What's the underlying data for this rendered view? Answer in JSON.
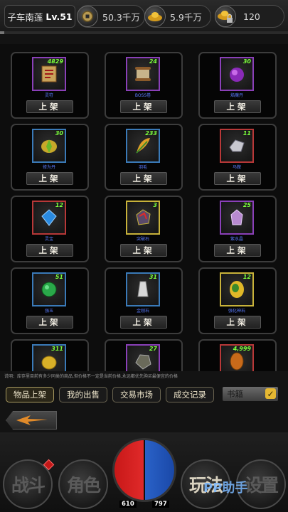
{
  "topbar": {
    "player_name": "子车南莲",
    "level": "Lv.51",
    "resources": [
      {
        "icon": "coin-icon",
        "value": "50.3千万"
      },
      {
        "icon": "gold-ingot-icon",
        "value": "5.9千万"
      },
      {
        "icon": "locked-ingot-icon",
        "value": "120"
      }
    ],
    "progress_fraction": 0.015
  },
  "items": [
    {
      "name": "灵符",
      "qty": "4829",
      "rarity": "purple",
      "icon": "talisman-scroll-icon",
      "button": "上架"
    },
    {
      "name": "BOSS卷",
      "qty": "24",
      "rarity": "purple",
      "icon": "boss-scroll-icon",
      "button": "上架"
    },
    {
      "name": "焰魔丹",
      "qty": "30",
      "rarity": "purple",
      "icon": "flame-pill-icon",
      "button": "上架"
    },
    {
      "name": "修为丹",
      "qty": "30",
      "rarity": "blue",
      "icon": "cultivation-pill-icon",
      "button": "上架"
    },
    {
      "name": "羽毛",
      "qty": "233",
      "rarity": "blue",
      "icon": "feather-icon",
      "button": "上架"
    },
    {
      "name": "马鞍",
      "qty": "11",
      "rarity": "red",
      "icon": "saddle-icon",
      "button": "上架"
    },
    {
      "name": "灵宝",
      "qty": "12",
      "rarity": "red",
      "icon": "gem-icon",
      "button": "上架"
    },
    {
      "name": "突破石",
      "qty": "3",
      "rarity": "yellow",
      "icon": "breakthrough-stone-icon",
      "button": "上架"
    },
    {
      "name": "紫水晶",
      "qty": "25",
      "rarity": "purple",
      "icon": "amethyst-icon",
      "button": "上架"
    },
    {
      "name": "强玉",
      "qty": "51",
      "rarity": "blue",
      "icon": "jade-icon",
      "button": "上架"
    },
    {
      "name": "金刚石",
      "qty": "31",
      "rarity": "blue",
      "icon": "diamond-icon",
      "button": "上架"
    },
    {
      "name": "强化神石",
      "qty": "12",
      "rarity": "yellow",
      "icon": "enhance-stone-icon",
      "button": "上架"
    },
    {
      "name": "",
      "qty": "311",
      "rarity": "blue",
      "icon": "gold-nugget-icon",
      "button": ""
    },
    {
      "name": "",
      "qty": "27",
      "rarity": "purple",
      "icon": "ore-icon",
      "button": ""
    },
    {
      "name": "",
      "qty": "4,999",
      "rarity": "red",
      "icon": "pinecone-icon",
      "button": ""
    }
  ],
  "note": "说明：库存里目前有多少同类的商品,但价格不一定是当前价格,永远都优先购买最便宜的价格",
  "tabs": [
    "物品上架",
    "我的出售",
    "交易市场",
    "成交记录"
  ],
  "filter": {
    "label": "书籍",
    "checked": true
  },
  "hud": {
    "buttons": [
      "战斗",
      "角色",
      "玩法",
      "设置"
    ],
    "hp": "610",
    "mp": "797",
    "watermark": "PP助手"
  },
  "colors": {
    "qty": "#7cff3c",
    "item_name": "#5a7cff",
    "hp": "#e02a2a",
    "mp": "#2a62c8"
  }
}
